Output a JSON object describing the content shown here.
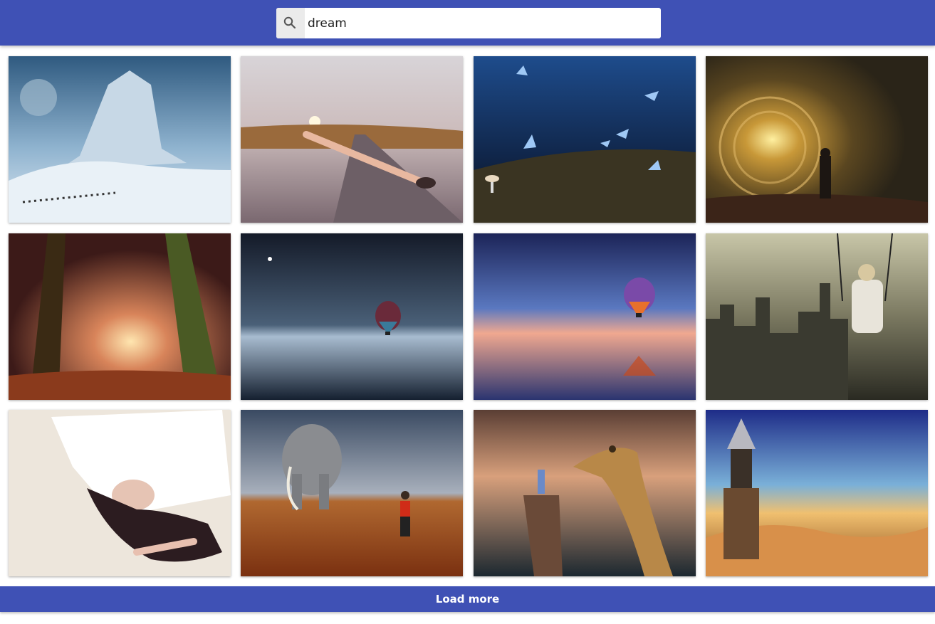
{
  "search": {
    "value": "dream",
    "icon": "search-icon"
  },
  "colors": {
    "primary": "#3f51b5"
  },
  "grid": {
    "images": [
      {
        "name": "ice-giant-image"
      },
      {
        "name": "swimmer-on-road-image"
      },
      {
        "name": "blue-butterflies-image"
      },
      {
        "name": "light-portal-image"
      },
      {
        "name": "autumn-forest-image"
      },
      {
        "name": "balloon-night-sea-image"
      },
      {
        "name": "balloon-sunset-sea-image"
      },
      {
        "name": "girl-swing-city-image"
      },
      {
        "name": "sleeping-woman-image"
      },
      {
        "name": "elephant-hiker-image"
      },
      {
        "name": "giraffe-cliff-image"
      },
      {
        "name": "tower-clouds-image"
      }
    ]
  },
  "load_more": {
    "label": "Load more"
  }
}
